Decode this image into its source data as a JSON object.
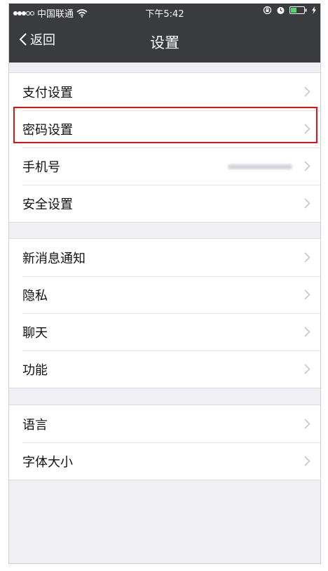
{
  "status_bar": {
    "carrier": "中国联通",
    "time": "下午5:42"
  },
  "nav": {
    "back_label": "返回",
    "title": "设置"
  },
  "groups": [
    {
      "items": [
        {
          "label": "支付设置"
        },
        {
          "label": "密码设置",
          "highlighted": true
        },
        {
          "label": "手机号",
          "value_blurred": true
        },
        {
          "label": "安全设置"
        }
      ]
    },
    {
      "items": [
        {
          "label": "新消息通知"
        },
        {
          "label": "隐私"
        },
        {
          "label": "聊天"
        },
        {
          "label": "功能"
        }
      ]
    },
    {
      "items": [
        {
          "label": "语言"
        },
        {
          "label": "字体大小"
        }
      ]
    }
  ],
  "colors": {
    "nav_background": "#3a3b3f",
    "page_background": "#efeff4",
    "highlight_border": "#d9151b"
  }
}
